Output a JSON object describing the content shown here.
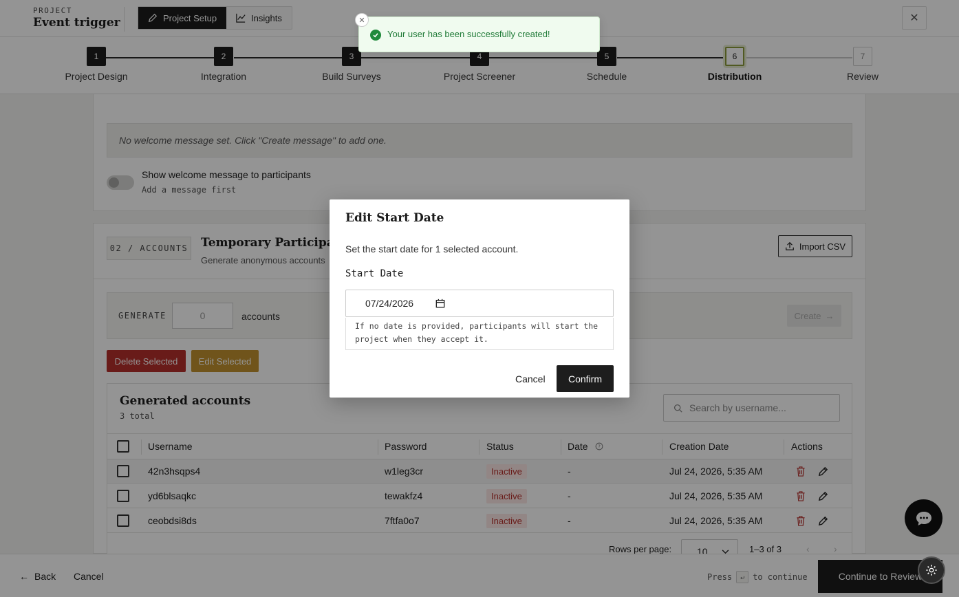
{
  "header": {
    "project_label": "PROJECT",
    "project_name": "Event trigger",
    "nav": [
      {
        "label": "Project Setup"
      },
      {
        "label": "Insights"
      }
    ]
  },
  "stepper": {
    "steps": [
      {
        "num": "1",
        "label": "Project Design"
      },
      {
        "num": "2",
        "label": "Integration"
      },
      {
        "num": "3",
        "label": "Build Surveys"
      },
      {
        "num": "4",
        "label": "Project Screener"
      },
      {
        "num": "5",
        "label": "Schedule"
      },
      {
        "num": "6",
        "label": "Distribution"
      },
      {
        "num": "7",
        "label": "Review"
      }
    ],
    "current": 6
  },
  "welcome": {
    "empty_message": "No welcome message set. Click \"Create message\" to add one.",
    "toggle_label": "Show welcome message to participants",
    "toggle_sub": "Add a message first"
  },
  "accounts": {
    "tag": "02 / ACCOUNTS",
    "title": "Temporary Participan",
    "subtitle": "Generate anonymous accounts",
    "import_label": "Import CSV",
    "generate_label": "GENERATE",
    "generate_placeholder": "0",
    "generate_unit": "accounts",
    "create_label": "Create",
    "delete_selected": "Delete Selected",
    "edit_selected": "Edit Selected"
  },
  "table": {
    "title": "Generated accounts",
    "count": "3 total",
    "search_placeholder": "Search by username...",
    "columns": [
      "Username",
      "Password",
      "Status",
      "Date",
      "Creation Date",
      "Actions"
    ],
    "rows": [
      {
        "username": "42n3hsqps4",
        "password": "w1leg3cr",
        "status": "Inactive",
        "date": "-",
        "created": "Jul 24, 2026, 5:35 AM"
      },
      {
        "username": "yd6blsaqkc",
        "password": "tewakfz4",
        "status": "Inactive",
        "date": "-",
        "created": "Jul 24, 2026, 5:35 AM"
      },
      {
        "username": "ceobdsi8ds",
        "password": "7ftfa0o7",
        "status": "Inactive",
        "date": "-",
        "created": "Jul 24, 2026, 5:35 AM"
      }
    ],
    "rows_per_page_label": "Rows per page:",
    "rows_per_page": "10",
    "range": "1–3 of 3"
  },
  "footer": {
    "back": "Back",
    "cancel": "Cancel",
    "hint_press": "Press",
    "hint_key": "↵",
    "hint_suffix": "to continue",
    "continue": "Continue to Review"
  },
  "modal": {
    "title": "Edit Start Date",
    "description": "Set the start date for 1 selected account.",
    "field_label": "Start Date",
    "date_value": "07/24/2026",
    "help": "If no date is provided, participants will start the project when they accept it.",
    "cancel": "Cancel",
    "confirm": "Confirm"
  },
  "toast": {
    "message": "Your user has been successfully created!"
  },
  "colors": {
    "danger": "#b5302c",
    "warning": "#c2912f",
    "success": "#1f8a3b",
    "dark": "#1d1d1d"
  }
}
